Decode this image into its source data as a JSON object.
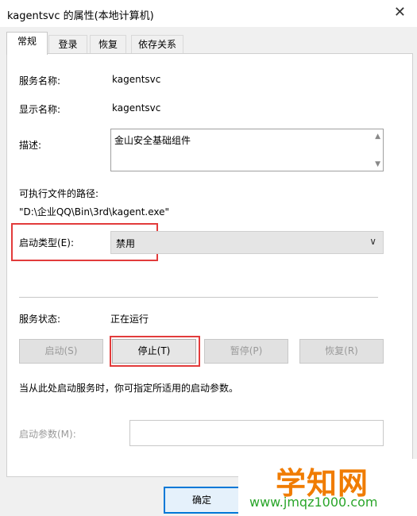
{
  "window": {
    "title": "kagentsvc 的属性(本地计算机)"
  },
  "tabs": [
    {
      "label": "常规"
    },
    {
      "label": "登录"
    },
    {
      "label": "恢复"
    },
    {
      "label": "依存关系"
    }
  ],
  "general": {
    "service_name_label": "服务名称:",
    "service_name_value": "kagentsvc",
    "display_name_label": "显示名称:",
    "display_name_value": "kagentsvc",
    "description_label": "描述:",
    "description_value": "金山安全基础组件",
    "path_label": "可执行文件的路径:",
    "path_value": "\"D:\\企业QQ\\Bin\\3rd\\kagent.exe\"",
    "startup_type_label": "启动类型(E):",
    "startup_type_value": "禁用",
    "status_label": "服务状态:",
    "status_value": "正在运行",
    "buttons": {
      "start": "启动(S)",
      "stop": "停止(T)",
      "pause": "暂停(P)",
      "resume": "恢复(R)"
    },
    "hint": "当从此处启动服务时，你可指定所适用的启动参数。",
    "start_params_label": "启动参数(M):",
    "start_params_value": ""
  },
  "footer": {
    "ok_label": "确定"
  },
  "watermark": {
    "title": "学知网",
    "url": "www.jmqz1000.com"
  },
  "icons": {
    "close": "close-icon",
    "dropdown": "chevron-down-icon"
  },
  "colors": {
    "highlight": "#e23b3b",
    "focus": "#0078d7"
  }
}
